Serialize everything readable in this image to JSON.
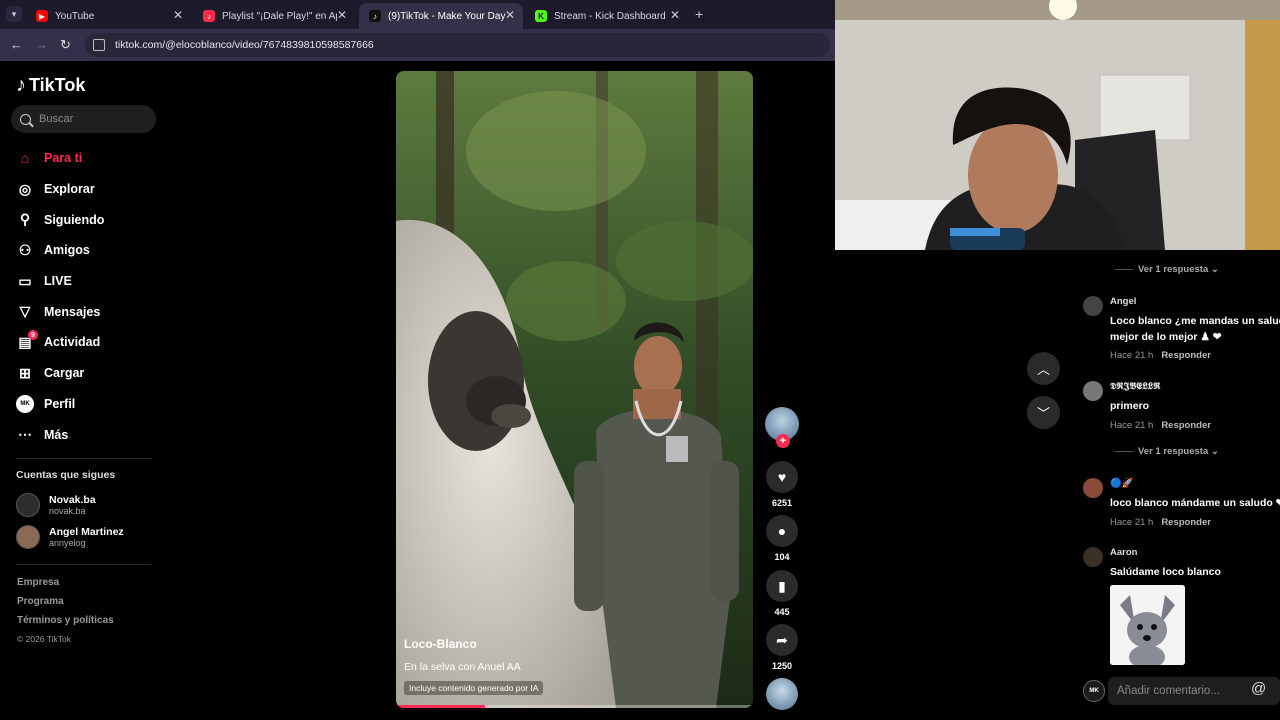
{
  "browser": {
    "tabs": [
      {
        "title": "YouTube",
        "icon": "youtube-icon",
        "color": "#ff0000"
      },
      {
        "title": "Playlist \"¡Dale Play!\" en Apple M",
        "icon": "apple-music-icon",
        "color": "#fa2d48"
      },
      {
        "title": "(9)TikTok - Make Your Day",
        "icon": "tiktok-icon",
        "color": "#111111"
      },
      {
        "title": "Stream - Kick Dashboard",
        "icon": "kick-icon",
        "color": "#53fc18"
      }
    ],
    "url": "tiktok.com/@elocoblanco/video/7674839810598587666"
  },
  "sidebar": {
    "logo": "TikTok",
    "search_placeholder": "Buscar",
    "menu": [
      {
        "label": "Para ti",
        "icon": "home-icon",
        "active": true
      },
      {
        "label": "Explorar",
        "icon": "compass-icon"
      },
      {
        "label": "Siguiendo",
        "icon": "following-icon"
      },
      {
        "label": "Amigos",
        "icon": "friends-icon"
      },
      {
        "label": "LIVE",
        "icon": "live-icon"
      },
      {
        "label": "Mensajes",
        "icon": "messages-icon"
      },
      {
        "label": "Actividad",
        "icon": "activity-icon",
        "badge": "9"
      },
      {
        "label": "Cargar",
        "icon": "upload-icon"
      },
      {
        "label": "Perfil",
        "icon": "profile-icon"
      },
      {
        "label": "Más",
        "icon": "more-icon"
      }
    ],
    "following_title": "Cuentas que sigues",
    "following": [
      {
        "name": "Novak.ba",
        "handle": "novak.ba"
      },
      {
        "name": "Angel Martinez",
        "handle": "annyelog"
      }
    ],
    "footer": [
      "Empresa",
      "Programa",
      "Términos y políticas"
    ],
    "copyright": "© 2026 TikTok"
  },
  "video": {
    "username": "Loco-Blanco",
    "description": "En la selva con Anuel AA",
    "ai_label": "Incluye contenido generado por IA",
    "progress": 0.25
  },
  "actions": {
    "likes": "6251",
    "comments": "104",
    "saves": "445",
    "shares": "1250"
  },
  "comments": {
    "replies_label": "Ver 1 respuesta",
    "items": [
      {
        "name": "Angel",
        "text": [
          "Loco blanco ¿me mandas un saludo",
          "mejor de lo mejor ♟ ❤"
        ],
        "time": "Hace 21 h",
        "reply": "Responder"
      },
      {
        "name": "𝕯𝕽𝕵𝕭𝕰𝕷𝕷𝕽",
        "text": [
          "primero"
        ],
        "time": "Hace 21 h",
        "reply": "Responder"
      },
      {
        "name": "🔵🚀",
        "text": [
          "loco blanco mándame un saludo ❤"
        ],
        "time": "Hace 21 h",
        "reply": "Responder"
      },
      {
        "name": "Aaron",
        "text": [
          "Salúdame loco blanco"
        ]
      }
    ],
    "add_placeholder": "Añadir comentario...",
    "at_symbol": "@"
  }
}
